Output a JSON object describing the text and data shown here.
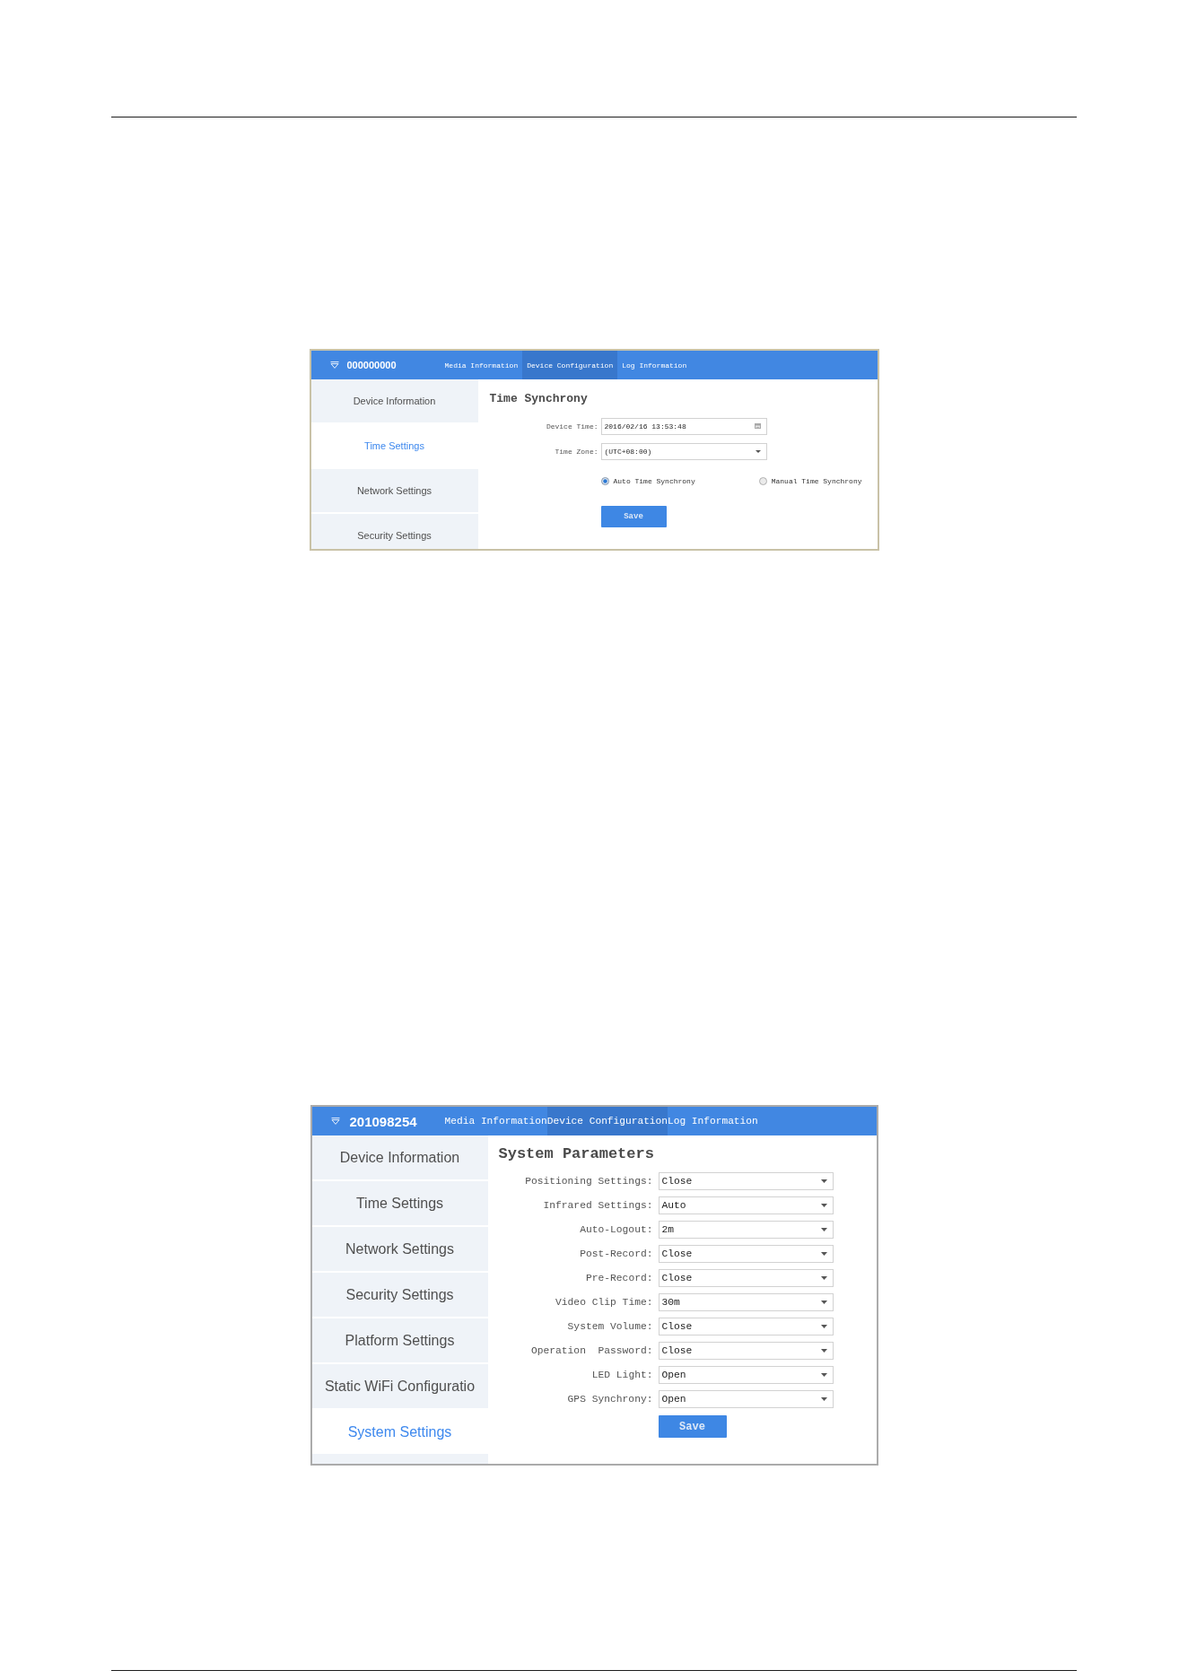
{
  "screenshots": [
    {
      "header": {
        "device_id": "000000000",
        "tabs": [
          {
            "label": "Media Information",
            "selected": false
          },
          {
            "label": "Device Configuration",
            "selected": true
          },
          {
            "label": "Log Information",
            "selected": false
          }
        ]
      },
      "sidebar": {
        "items": [
          {
            "label": "Device Information",
            "selected": false
          },
          {
            "label": "Time Settings",
            "selected": true
          },
          {
            "label": "Network Settings",
            "selected": false
          },
          {
            "label": "Security Settings",
            "selected": false
          }
        ]
      },
      "panel": {
        "title": "Time Synchrony",
        "fields": [
          {
            "kind": "date",
            "label": "Device Time:",
            "value": "2016/02/16 13:53:48"
          },
          {
            "kind": "select",
            "label": "Time Zone:",
            "value": "(UTC+08:00)"
          }
        ],
        "radios": [
          {
            "label": "Auto Time Synchrony",
            "selected": true
          },
          {
            "label": "Manual Time Synchrony",
            "selected": false
          }
        ],
        "save_button": "Save"
      }
    },
    {
      "header": {
        "device_id": "201098254",
        "tabs": [
          {
            "label": "Media Information",
            "selected": false
          },
          {
            "label": "Device Configuration",
            "selected": true
          },
          {
            "label": "Log Information",
            "selected": false
          }
        ]
      },
      "sidebar": {
        "items": [
          {
            "label": "Device Information",
            "selected": false
          },
          {
            "label": "Time Settings",
            "selected": false
          },
          {
            "label": "Network Settings",
            "selected": false
          },
          {
            "label": "Security Settings",
            "selected": false
          },
          {
            "label": "Platform Settings",
            "selected": false
          },
          {
            "label": "Static WiFi Configuratio",
            "selected": false
          },
          {
            "label": "System Settings",
            "selected": true
          }
        ]
      },
      "panel": {
        "title": "System Parameters",
        "fields": [
          {
            "kind": "select",
            "label": "Positioning Settings:",
            "value": "Close"
          },
          {
            "kind": "select",
            "label": "Infrared Settings:",
            "value": "Auto"
          },
          {
            "kind": "select",
            "label": "Auto-Logout:",
            "value": "2m"
          },
          {
            "kind": "select",
            "label": "Post-Record:",
            "value": "Close"
          },
          {
            "kind": "select",
            "label": "Pre-Record:",
            "value": "Close"
          },
          {
            "kind": "select",
            "label": "Video Clip Time:",
            "value": "30m"
          },
          {
            "kind": "select",
            "label": "System Volume:",
            "value": "Close"
          },
          {
            "kind": "select",
            "label": "Operation  Password:",
            "value": "Close"
          },
          {
            "kind": "select",
            "label": "LED Light:",
            "value": "Open"
          },
          {
            "kind": "select",
            "label": "GPS Synchrony:",
            "value": "Open"
          }
        ],
        "save_button": "Save"
      }
    }
  ]
}
